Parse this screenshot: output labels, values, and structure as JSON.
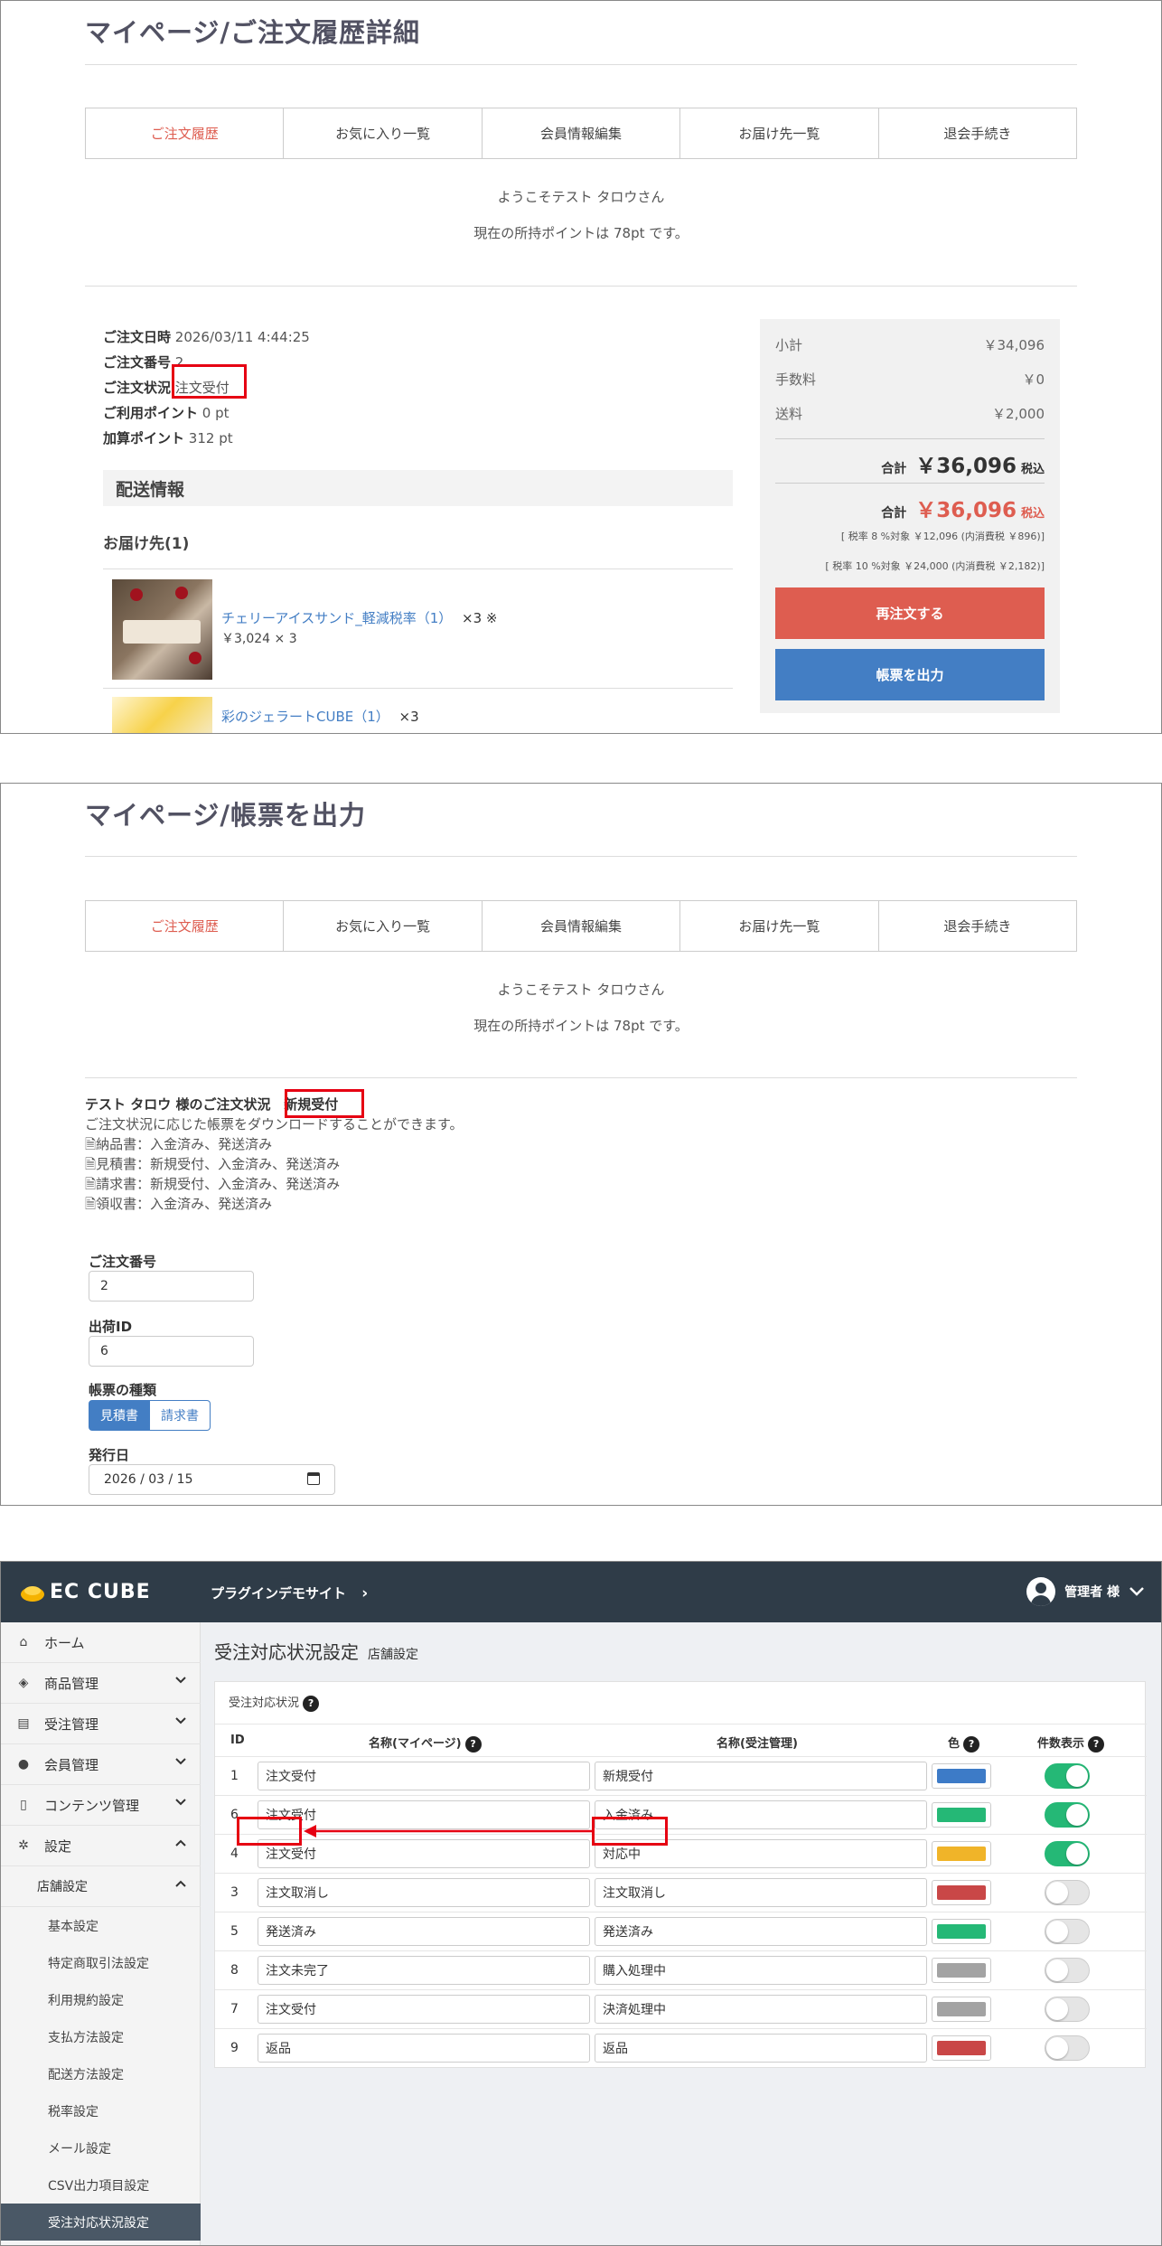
{
  "panel1": {
    "title": "マイページ/ご注文履歴詳細",
    "tabs": [
      "ご注文履歴",
      "お気に入り一覧",
      "会員情報編集",
      "お届け先一覧",
      "退会手続き"
    ],
    "welcome": "ようこそテスト タロウさん",
    "points_line": "現在の所持ポイントは 78pt です。",
    "order": {
      "date_label": "ご注文日時",
      "date": "2026/03/11 4:44:25",
      "number_label": "ご注文番号",
      "number": "2",
      "status_label": "ご注文状況",
      "status": "注文受付",
      "used_label": "ご利用ポイント",
      "used": "0 pt",
      "added_label": "加算ポイント",
      "added": "312 pt"
    },
    "shipping_heading": "配送情報",
    "destination": "お届け先(1)",
    "items": [
      {
        "name": "チェリーアイスサンド_軽減税率（1）",
        "qty": "×3 ※",
        "price": "￥3,024 × 3"
      },
      {
        "name": "彩のジェラートCUBE（1）",
        "qty": "×3"
      }
    ],
    "summary": {
      "subtotal_label": "小計",
      "subtotal": "￥34,096",
      "fee_label": "手数料",
      "fee": "￥0",
      "shipping_label": "送料",
      "shipping": "￥2,000",
      "total_label": "合計",
      "total": "￥36,096",
      "tax_in": "税込",
      "total2_label": "合計",
      "total2": "￥36,096",
      "tax_in2": "税込",
      "tax8": "[ 税率 8 %対象 ￥12,096 (内消費税 ￥896)]",
      "tax10": "[ 税率 10 %対象 ￥24,000 (内消費税 ￥2,182)]",
      "reorder": "再注文する",
      "output": "帳票を出力"
    }
  },
  "panel2": {
    "title": "マイページ/帳票を出力",
    "tabs": [
      "ご注文履歴",
      "お気に入り一覧",
      "会員情報編集",
      "お届け先一覧",
      "退会手続き"
    ],
    "welcome": "ようこそテスト タロウさん",
    "points_line": "現在の所持ポイントは 78pt です。",
    "status_prefix": "テスト タロウ 様のご注文状況",
    "status": "新規受付",
    "desc": "ご注文状況に応じた帳票をダウンロードすることができます。",
    "docs": [
      "納品書：入金済み、発送済み",
      "見積書：新規受付、入金済み、発送済み",
      "請求書：新規受付、入金済み、発送済み",
      "領収書：入金済み、発送済み"
    ],
    "order_no_label": "ご注文番号",
    "order_no": "2",
    "ship_id_label": "出荷ID",
    "ship_id": "6",
    "type_label": "帳票の種類",
    "type_opts": [
      "見積書",
      "請求書"
    ],
    "issue_label": "発行日",
    "issue_date": "2026 / 03 / 15"
  },
  "panel3": {
    "logo": "EC CUBE",
    "site": "プラグインデモサイト",
    "admin": "管理者 様",
    "menu": {
      "home": "ホーム",
      "products": "商品管理",
      "orders": "受注管理",
      "members": "会員管理",
      "contents": "コンテンツ管理",
      "settings": "設定",
      "store": "店舗設定",
      "sub": [
        "基本設定",
        "特定商取引法設定",
        "利用規約設定",
        "支払方法設定",
        "配送方法設定",
        "税率設定",
        "メール設定",
        "CSV出力項目設定",
        "受注対応状況設定"
      ]
    },
    "page_title": "受注対応状況設定",
    "page_sub": "店舗設定",
    "card_title": "受注対応状況",
    "headers": {
      "id": "ID",
      "mypage": "名称(マイページ)",
      "admin": "名称(受注管理)",
      "color": "色",
      "count": "件数表示"
    },
    "rows": [
      {
        "id": "1",
        "mypage": "注文受付",
        "admin": "新規受付",
        "color": "#3d7bc7",
        "on": true
      },
      {
        "id": "6",
        "mypage": "注文受付",
        "admin": "入金済み",
        "color": "#25b876",
        "on": true
      },
      {
        "id": "4",
        "mypage": "注文受付",
        "admin": "対応中",
        "color": "#f0b429",
        "on": true
      },
      {
        "id": "3",
        "mypage": "注文取消し",
        "admin": "注文取消し",
        "color": "#c94747",
        "on": false
      },
      {
        "id": "5",
        "mypage": "発送済み",
        "admin": "発送済み",
        "color": "#25b876",
        "on": false
      },
      {
        "id": "8",
        "mypage": "注文未完了",
        "admin": "購入処理中",
        "color": "#a3a3a3",
        "on": false
      },
      {
        "id": "7",
        "mypage": "注文受付",
        "admin": "決済処理中",
        "color": "#a3a3a3",
        "on": false
      },
      {
        "id": "9",
        "mypage": "返品",
        "admin": "返品",
        "color": "#c94747",
        "on": false
      }
    ]
  }
}
